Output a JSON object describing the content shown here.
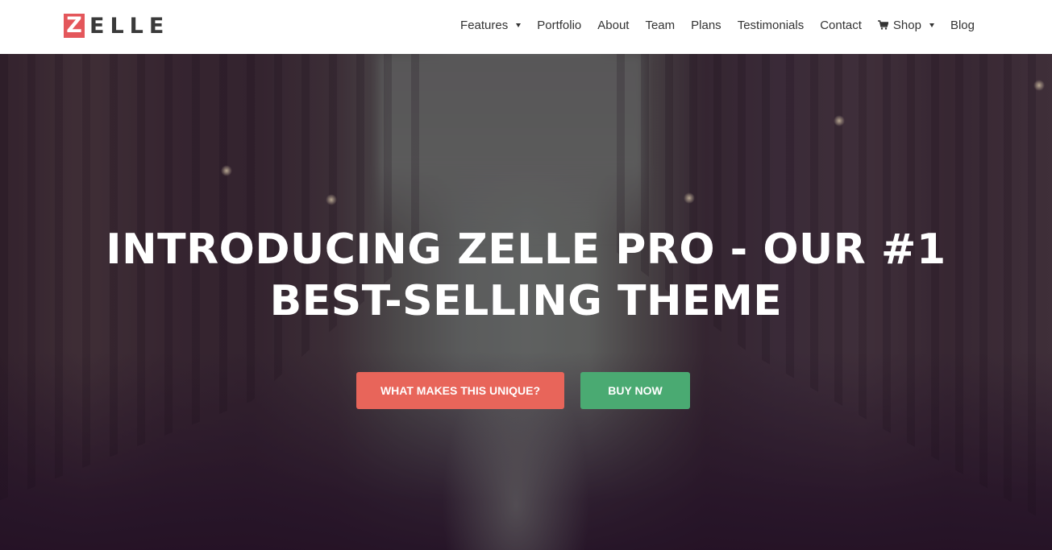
{
  "header": {
    "logo": {
      "letter": "Z",
      "rest": "ELLE",
      "accent_color": "#e4575b"
    },
    "nav": [
      {
        "label": "Features",
        "dropdown": true
      },
      {
        "label": "Portfolio",
        "dropdown": false
      },
      {
        "label": "About",
        "dropdown": false
      },
      {
        "label": "Team",
        "dropdown": false
      },
      {
        "label": "Plans",
        "dropdown": false
      },
      {
        "label": "Testimonials",
        "dropdown": false
      },
      {
        "label": "Contact",
        "dropdown": false
      },
      {
        "label": "Shop",
        "dropdown": true,
        "icon": "cart-icon"
      },
      {
        "label": "Blog",
        "dropdown": false
      }
    ]
  },
  "hero": {
    "title_line_1": "INTRODUCING ZELLE PRO - OUR #1",
    "title_line_2": "BEST-SELLING THEME",
    "buttons": {
      "primary": {
        "label": "WHAT MAKES THIS UNIQUE?",
        "color": "#e8655a"
      },
      "secondary": {
        "label": "BUY NOW",
        "color": "#4aaa72"
      }
    }
  }
}
